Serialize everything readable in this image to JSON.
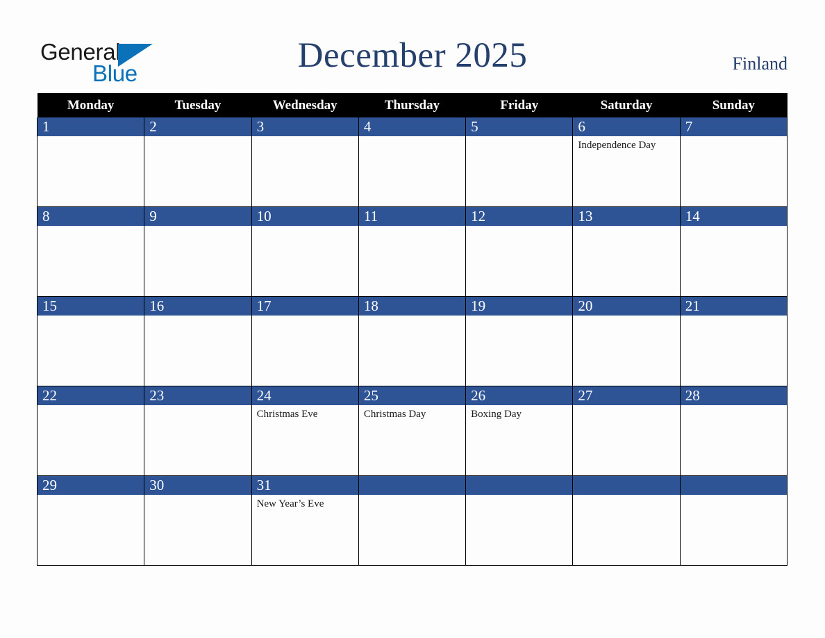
{
  "brand": {
    "word_one": "General",
    "word_two": "Blue",
    "triangle_color": "#0b72b9",
    "word_one_color": "#1a1a1a",
    "word_two_color": "#0b72b9"
  },
  "header": {
    "title": "December 2025",
    "country": "Finland",
    "title_color": "#26406d"
  },
  "theme": {
    "header_row_bg": "#000000",
    "header_row_text": "#ffffff",
    "date_band_bg": "#2f5496",
    "date_band_text": "#ffffff",
    "grid_line": "#000000",
    "page_bg": "#fdfdfd",
    "event_text": "#1a1a1a"
  },
  "weekdays": [
    "Monday",
    "Tuesday",
    "Wednesday",
    "Thursday",
    "Friday",
    "Saturday",
    "Sunday"
  ],
  "weeks": [
    [
      {
        "date": "1",
        "events": []
      },
      {
        "date": "2",
        "events": []
      },
      {
        "date": "3",
        "events": []
      },
      {
        "date": "4",
        "events": []
      },
      {
        "date": "5",
        "events": []
      },
      {
        "date": "6",
        "events": [
          "Independence Day"
        ]
      },
      {
        "date": "7",
        "events": []
      }
    ],
    [
      {
        "date": "8",
        "events": []
      },
      {
        "date": "9",
        "events": []
      },
      {
        "date": "10",
        "events": []
      },
      {
        "date": "11",
        "events": []
      },
      {
        "date": "12",
        "events": []
      },
      {
        "date": "13",
        "events": []
      },
      {
        "date": "14",
        "events": []
      }
    ],
    [
      {
        "date": "15",
        "events": []
      },
      {
        "date": "16",
        "events": []
      },
      {
        "date": "17",
        "events": []
      },
      {
        "date": "18",
        "events": []
      },
      {
        "date": "19",
        "events": []
      },
      {
        "date": "20",
        "events": []
      },
      {
        "date": "21",
        "events": []
      }
    ],
    [
      {
        "date": "22",
        "events": []
      },
      {
        "date": "23",
        "events": []
      },
      {
        "date": "24",
        "events": [
          "Christmas Eve"
        ]
      },
      {
        "date": "25",
        "events": [
          "Christmas Day"
        ]
      },
      {
        "date": "26",
        "events": [
          "Boxing Day"
        ]
      },
      {
        "date": "27",
        "events": []
      },
      {
        "date": "28",
        "events": []
      }
    ],
    [
      {
        "date": "29",
        "events": []
      },
      {
        "date": "30",
        "events": []
      },
      {
        "date": "31",
        "events": [
          "New Year’s Eve"
        ]
      },
      {
        "date": "",
        "events": []
      },
      {
        "date": "",
        "events": []
      },
      {
        "date": "",
        "events": []
      },
      {
        "date": "",
        "events": []
      }
    ]
  ]
}
